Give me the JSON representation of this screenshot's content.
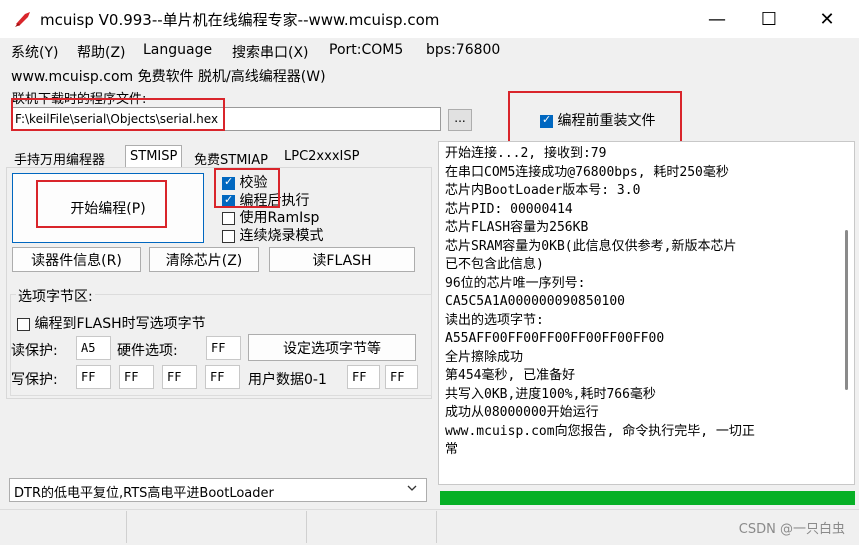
{
  "window": {
    "title": "mcuisp V0.993--单片机在线编程专家--www.mcuisp.com",
    "minimize": "—",
    "maximize": "☐",
    "close": "✕"
  },
  "menu": {
    "items": [
      "系统(Y)",
      "帮助(Z)",
      "Language",
      "搜索串口(X)",
      "Port:COM5",
      "bps:76800"
    ],
    "line2": "www.mcuisp.com 免费软件 脱机/高线编程器(W)"
  },
  "file": {
    "label": "联机下载时的程序文件:",
    "path": "F:\\keilFile\\serial\\Objects\\serial.hex",
    "browse": "...",
    "reload_label": "编程前重装文件",
    "reload_checked": true
  },
  "tabs": [
    "手持万用编程器",
    "STMISP",
    "免费STMIAP",
    "LPC2xxxISP"
  ],
  "tab_active": 1,
  "program": {
    "start_button": "开始编程(P)",
    "options": [
      {
        "label": "校验",
        "checked": true
      },
      {
        "label": "编程后执行",
        "checked": true
      },
      {
        "label": "使用RamIsp",
        "checked": false
      },
      {
        "label": "连续烧录模式",
        "checked": false
      }
    ],
    "read_info": "读器件信息(R)",
    "erase_chip": "清除芯片(Z)",
    "read_flash": "读FLASH"
  },
  "option_bytes": {
    "title": "选项字节区:",
    "write_opt_label": "编程到FLASH时写选项字节",
    "write_opt_checked": false,
    "read_protect_label": "读保护:",
    "read_protect_value": "A5",
    "hw_option_label": "硬件选项:",
    "hw_option_value": "FF",
    "set_button": "设定选项字节等",
    "write_protect_label": "写保护:",
    "write_protect_values": [
      "FF",
      "FF",
      "FF",
      "FF"
    ],
    "user_data_label": "用户数据0-1",
    "user_data_values": [
      "FF",
      "FF"
    ]
  },
  "bootloader_mode": "DTR的低电平复位,RTS高电平进BootLoader",
  "log": [
    "开始连接...2, 接收到:79",
    "在串口COM5连接成功@76800bps, 耗时250毫秒",
    "芯片内BootLoader版本号: 3.0",
    "芯片PID: 00000414",
    "芯片FLASH容量为256KB",
    "芯片SRAM容量为0KB(此信息仅供参考,新版本芯片",
    "已不包含此信息)",
    "96位的芯片唯一序列号:",
    "CA5C5A1A000000090850100",
    "读出的选项字节:",
    "A55AFF00FF00FF00FF00FF00FF00",
    "全片擦除成功",
    "第454毫秒, 已准备好",
    "共写入0KB,进度100%,耗时766毫秒",
    "成功从08000000开始运行",
    "www.mcuisp.com向您报告, 命令执行完毕, 一切正",
    "常"
  ],
  "progress_percent": 100,
  "colors": {
    "highlight": "#d9252b",
    "accent": "#0067c0",
    "progress": "#06b025"
  },
  "watermark": "CSDN @一只白虫"
}
